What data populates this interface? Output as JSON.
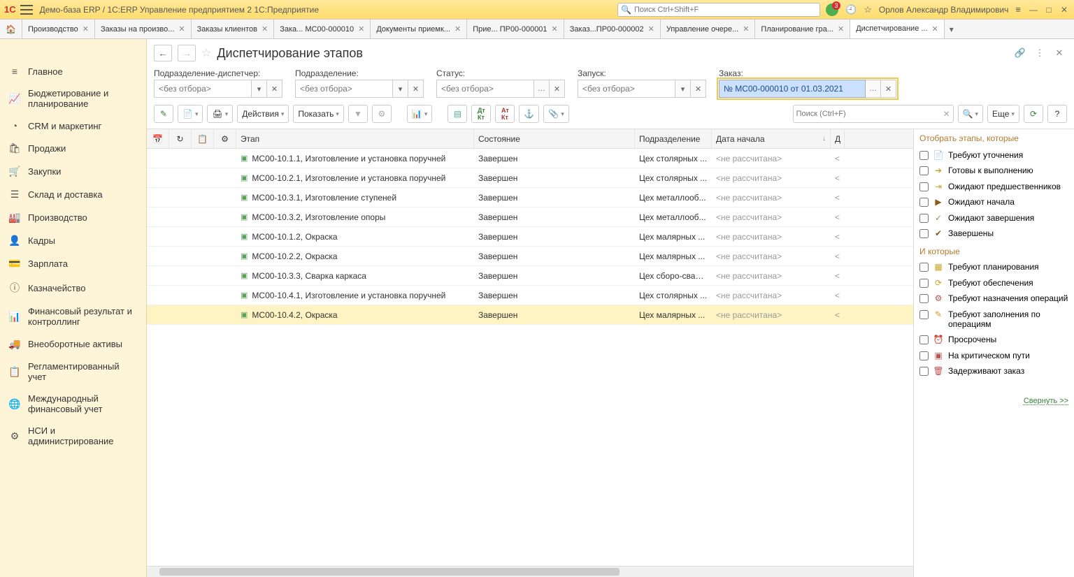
{
  "titlebar": {
    "app_title": "Демо-база ERP / 1С:ERP Управление предприятием 2 1С:Предприятие",
    "search_placeholder": "Поиск Ctrl+Shift+F",
    "notification_count": "3",
    "user_name": "Орлов Александр Владимирович"
  },
  "tabs": [
    {
      "label": "Производство"
    },
    {
      "label": "Заказы на произво..."
    },
    {
      "label": "Заказы клиентов"
    },
    {
      "label": "Зака... МС00-000010"
    },
    {
      "label": "Документы приемк..."
    },
    {
      "label": "Прие... ПР00-000001"
    },
    {
      "label": "Заказ...ПР00-000002"
    },
    {
      "label": "Управление очере..."
    },
    {
      "label": "Планирование гра..."
    },
    {
      "label": "Диспетчирование ...",
      "active": true
    }
  ],
  "sidebar": [
    {
      "icon": "≡",
      "label": "Главное"
    },
    {
      "icon": "📈",
      "label": "Бюджетирование и планирование"
    },
    {
      "icon": "◔",
      "label": "CRM и маркетинг"
    },
    {
      "icon": "🛍",
      "label": "Продажи"
    },
    {
      "icon": "🛒",
      "label": "Закупки"
    },
    {
      "icon": "☰",
      "label": "Склад и доставка"
    },
    {
      "icon": "🏭",
      "label": "Производство"
    },
    {
      "icon": "👤",
      "label": "Кадры"
    },
    {
      "icon": "💳",
      "label": "Зарплата"
    },
    {
      "icon": "ⓘ",
      "label": "Казначейство"
    },
    {
      "icon": "📊",
      "label": "Финансовый результат и контроллинг"
    },
    {
      "icon": "🚚",
      "label": "Внеоборотные активы"
    },
    {
      "icon": "📋",
      "label": "Регламентированный учет"
    },
    {
      "icon": "🌐",
      "label": "Международный финансовый учет"
    },
    {
      "icon": "⚙",
      "label": "НСИ и администрирование"
    }
  ],
  "page": {
    "title": "Диспетчирование этапов"
  },
  "filters": {
    "dispatcher_label": "Подразделение-диспетчер:",
    "dispatcher_placeholder": "<без отбора>",
    "department_label": "Подразделение:",
    "department_placeholder": "<без отбора>",
    "status_label": "Статус:",
    "status_placeholder": "<без отбора>",
    "launch_label": "Запуск:",
    "launch_placeholder": "<без отбора>",
    "order_label": "Заказ:",
    "order_value": "№ МС00-000010 от 01.03.2021"
  },
  "toolbar": {
    "actions_label": "Действия",
    "show_label": "Показать",
    "more_label": "Еще",
    "search_placeholder": "Поиск (Ctrl+F)"
  },
  "table": {
    "headers": {
      "stage": "Этап",
      "state": "Состояние",
      "department": "Подразделение",
      "start_date": "Дата начала",
      "d": "Д"
    },
    "rows": [
      {
        "stage": "МС00-10.1.1, Изготовление и установка поручней",
        "state": "Завершен",
        "dept": "Цех столярных ...",
        "date": "<не рассчитана>"
      },
      {
        "stage": "МС00-10.2.1, Изготовление и установка поручней",
        "state": "Завершен",
        "dept": "Цех столярных ...",
        "date": "<не рассчитана>"
      },
      {
        "stage": "МС00-10.3.1, Изготовление ступеней",
        "state": "Завершен",
        "dept": "Цех металлооб...",
        "date": "<не рассчитана>"
      },
      {
        "stage": "МС00-10.3.2, Изготовление опоры",
        "state": "Завершен",
        "dept": "Цех металлооб...",
        "date": "<не рассчитана>"
      },
      {
        "stage": "МС00-10.1.2, Окраска",
        "state": "Завершен",
        "dept": "Цех малярных ...",
        "date": "<не рассчитана>"
      },
      {
        "stage": "МС00-10.2.2, Окраска",
        "state": "Завершен",
        "dept": "Цех малярных ...",
        "date": "<не рассчитана>"
      },
      {
        "stage": "МС00-10.3.3, Сварка каркаса",
        "state": "Завершен",
        "dept": "Цех сборо-сварки",
        "date": "<не рассчитана>"
      },
      {
        "stage": "МС00-10.4.1, Изготовление и установка поручней",
        "state": "Завершен",
        "dept": "Цех столярных ...",
        "date": "<не рассчитана>"
      },
      {
        "stage": "МС00-10.4.2, Окраска",
        "state": "Завершен",
        "dept": "Цех малярных ...",
        "date": "<не рассчитана>",
        "selected": true
      }
    ]
  },
  "right_panel": {
    "title1": "Отобрать этапы, которые",
    "items1": [
      {
        "icon": "📄",
        "color": "#c9a227",
        "label": "Требуют уточнения"
      },
      {
        "icon": "➔",
        "color": "#c9a227",
        "label": "Готовы к выполнению"
      },
      {
        "icon": "⇥",
        "color": "#c9a227",
        "label": "Ожидают предшественников"
      },
      {
        "icon": "▶",
        "color": "#8a5a1a",
        "label": "Ожидают начала"
      },
      {
        "icon": "✓",
        "color": "#6aa84f",
        "label": "Ожидают завершения"
      },
      {
        "icon": "✔",
        "color": "#8a5a1a",
        "label": "Завершены"
      }
    ],
    "title2": "И которые",
    "items2": [
      {
        "icon": "▦",
        "color": "#c9a227",
        "label": "Требуют планирования"
      },
      {
        "icon": "⟳",
        "color": "#c9a227",
        "label": "Требуют обеспечения"
      },
      {
        "icon": "⚙",
        "color": "#c0504d",
        "label": "Требуют назначения операций"
      },
      {
        "icon": "✎",
        "color": "#c9a227",
        "label": "Требуют заполнения по операциям"
      },
      {
        "icon": "⏰",
        "color": "#c0504d",
        "label": "Просрочены"
      },
      {
        "icon": "▣",
        "color": "#c0504d",
        "label": "На критическом пути"
      },
      {
        "icon": "🗑",
        "color": "#c0504d",
        "label": "Задерживают заказ"
      }
    ],
    "collapse": "Свернуть >>"
  }
}
